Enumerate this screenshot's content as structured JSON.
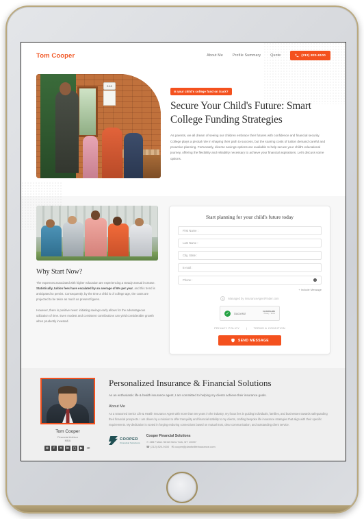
{
  "header": {
    "brand": "Tom Cooper",
    "nav": [
      {
        "label": "About Me"
      },
      {
        "label": "Profile Summary"
      },
      {
        "label": "Quote"
      }
    ],
    "phone_label": "(212) 820-9100"
  },
  "hero": {
    "badge": "Is your child's college fund on track?",
    "title": "Secure Your Child's Future: Smart College Funding Strategies",
    "body": "As parents, we all dream of seeing our children embrace their futures with confidence and financial security. College plays a pivotal role in shaping their path to success, but the soaring costs of tuition demand careful and proactive planning. Fortunately, diverse savings options are available to help secure your child's educational journey, offering the flexibility and reliability necessary to achieve your financial aspirations. Let's discuss some options.",
    "image_clock": "2:10"
  },
  "why": {
    "title": "Why Start Now?",
    "p1_a": "The expenses associated with higher education are experiencing a steady annual increase. ",
    "p1_b": "Statistically, tuition fees have escalated by an average of 6% per year",
    "p1_c": ", and this trend is anticipated to persist. Consequently, by the time a child is of college age, the costs are projected to be twice as much as present figures.",
    "p2": "However, there is positive news: initiating savings early allows for the advantageous utilization of time. Even modest and consistent contributions can yield considerable growth when prudently invested."
  },
  "form": {
    "title": "Start planning for your child's future today",
    "fields": [
      {
        "label": "First Name :"
      },
      {
        "label": "Last Name :"
      },
      {
        "label": "City, State :"
      },
      {
        "label": "E-mail :"
      },
      {
        "label": "Phone :"
      }
    ],
    "info_glyph": "i",
    "include_message": "+ Include Message",
    "managed_by": "Managed by InsuranceAgentFinder.com",
    "managed_glyph": "$",
    "captcha": {
      "status": "Success!",
      "check_glyph": "✓",
      "logo_name": "CLOUDFLARE",
      "logo_sub": "Privacy · Terms"
    },
    "legal": {
      "privacy": "PRIVACY POLICY",
      "divider": "|",
      "terms": "TERMS & CONDITION"
    },
    "send_label": "SEND MESSAGE"
  },
  "profile": {
    "name": "Tom Cooper",
    "role": "Financial Advisor",
    "credential": "MBA",
    "socials": [
      {
        "name": "globe-icon",
        "glyph": "⊕"
      },
      {
        "name": "facebook-icon",
        "glyph": "f"
      },
      {
        "name": "x-twitter-icon",
        "glyph": "✕"
      },
      {
        "name": "linkedin-icon",
        "glyph": "in"
      },
      {
        "name": "instagram-icon",
        "glyph": "▢"
      },
      {
        "name": "youtube-icon",
        "glyph": "▶"
      },
      {
        "name": "share-icon",
        "glyph": "≪"
      }
    ],
    "solutions_title": "Personalized Insurance & Financial Solutions",
    "solutions_sub": "As an enthusiastic life & health insurance agent, I am committed to helping my clients achieve their insurance goals.",
    "about_heading": "About Me",
    "about_body": "As a seasoned Senior Life & Health Insurance Agent with more than ten years in the industry, my focus lies in guiding individuals, families, and businesses towards safeguarding their financial prospects. I am driven by a mission to offer tranquility and financial stability to my clients, crafting bespoke life insurance strategies that align with their specific requirements. My dedication is rooted in forging enduring connections based on mutual trust, clear communication, and outstanding client service.",
    "company": {
      "logo_name": "COOPER",
      "logo_sub": "Financial Solutions",
      "title": "Cooper Financial Solutions",
      "address": "285 Fulton Street New York, NY 10007",
      "phone": "(212) 820-9100",
      "email": "cooper@planforlifeinsurance.com",
      "pin_glyph": "☉",
      "phone_glyph": "☎",
      "mail_glyph": "✉"
    }
  },
  "colors": {
    "accent": "#f4511e",
    "brand_teal": "#1f4f53",
    "success": "#25a244"
  }
}
